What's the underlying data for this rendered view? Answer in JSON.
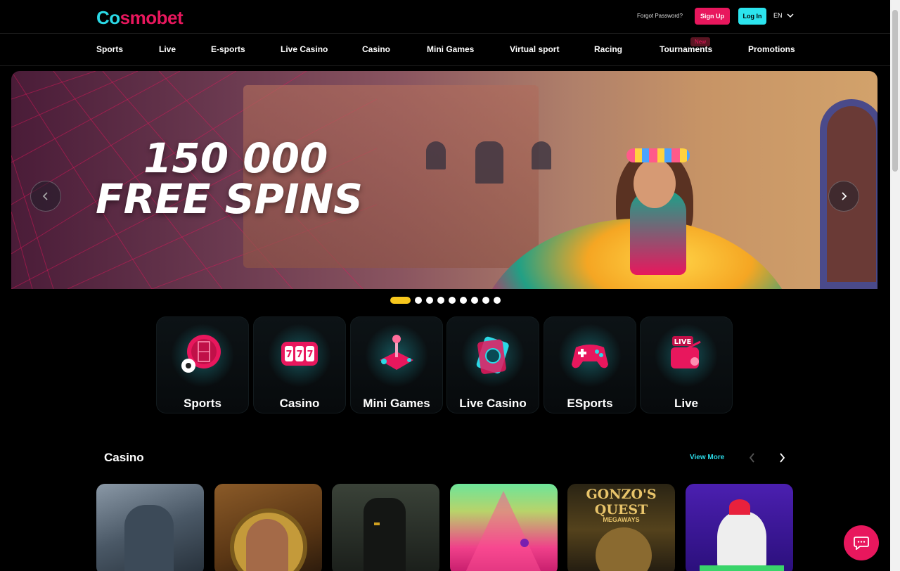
{
  "brand": {
    "logo_first": "C",
    "logo_rest": "smobet",
    "logo_o": "o",
    "accent": "#e8175d",
    "secondary": "#2bd9e6"
  },
  "header": {
    "forgot_password": "Forgot Password?",
    "signup": "Sign Up",
    "login": "Log In",
    "language": "EN"
  },
  "nav": {
    "items": [
      "Sports",
      "Live",
      "E-sports",
      "Live Casino",
      "Casino",
      "Mini Games",
      "Virtual sport",
      "Racing",
      "Tournaments",
      "Promotions"
    ],
    "new_badge": "New"
  },
  "banner": {
    "line1": "150 000",
    "line2": "FREE SPINS",
    "slide_count": 9,
    "active_slide": 1
  },
  "categories": [
    {
      "label": "Sports",
      "icon": "soccer-field-icon"
    },
    {
      "label": "Casino",
      "icon": "slot-machine-icon"
    },
    {
      "label": "Mini Games",
      "icon": "joystick-icon"
    },
    {
      "label": "Live Casino",
      "icon": "cards-chip-icon"
    },
    {
      "label": "ESports",
      "icon": "gamepad-icon"
    },
    {
      "label": "Live",
      "icon": "live-tv-icon"
    }
  ],
  "casino": {
    "title": "Casino",
    "view_more": "View More",
    "games": [
      {
        "name": "zeus-game-tile"
      },
      {
        "name": "explorer-game-tile"
      },
      {
        "name": "anubis-game-tile"
      },
      {
        "name": "plinko-game-tile"
      },
      {
        "name": "gonzos-quest-game-tile",
        "title_text": "GONZO'S QUEST",
        "subtitle_text": "MEGAWAYS"
      },
      {
        "name": "chicken-game-tile"
      }
    ]
  }
}
